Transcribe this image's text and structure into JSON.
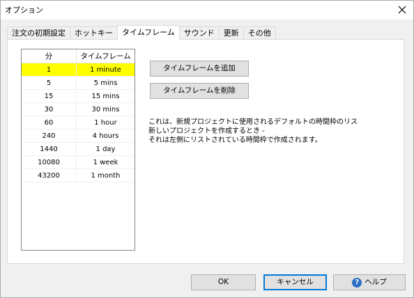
{
  "window": {
    "title": "オプション"
  },
  "tabs": [
    {
      "label": "注文の初期設定",
      "active": false
    },
    {
      "label": "ホットキー",
      "active": false
    },
    {
      "label": "タイムフレーム",
      "active": true
    },
    {
      "label": "サウンド",
      "active": false
    },
    {
      "label": "更新",
      "active": false
    },
    {
      "label": "その他",
      "active": false
    }
  ],
  "list": {
    "headers": [
      "分",
      "タイムフレーム"
    ],
    "rows": [
      {
        "minutes": "1",
        "timeframe": "1 minute",
        "selected": true
      },
      {
        "minutes": "5",
        "timeframe": "5 mins",
        "selected": false
      },
      {
        "minutes": "15",
        "timeframe": "15 mins",
        "selected": false
      },
      {
        "minutes": "30",
        "timeframe": "30 mins",
        "selected": false
      },
      {
        "minutes": "60",
        "timeframe": "1 hour",
        "selected": false
      },
      {
        "minutes": "240",
        "timeframe": "4 hours",
        "selected": false
      },
      {
        "minutes": "1440",
        "timeframe": "1 day",
        "selected": false
      },
      {
        "minutes": "10080",
        "timeframe": "1 week",
        "selected": false
      },
      {
        "minutes": "43200",
        "timeframe": "1 month",
        "selected": false
      }
    ]
  },
  "buttons": {
    "add_label": "タイムフレームを追加",
    "delete_label": "タイムフレームを削除",
    "ok_label": "OK",
    "cancel_label": "キャンセル",
    "help_label": "ヘルプ"
  },
  "description": {
    "line1": "これは、新規プロジェクトに使用されるデフォルトの時間枠のリス",
    "line2": "新しいプロジェクトを作成するとき -",
    "line3": "それは左側にリストされている時間枠で作成されます。"
  },
  "colors": {
    "selected_row": "#ffff00",
    "focus_border": "#0078d7",
    "help_icon": "#2f6fc7"
  }
}
